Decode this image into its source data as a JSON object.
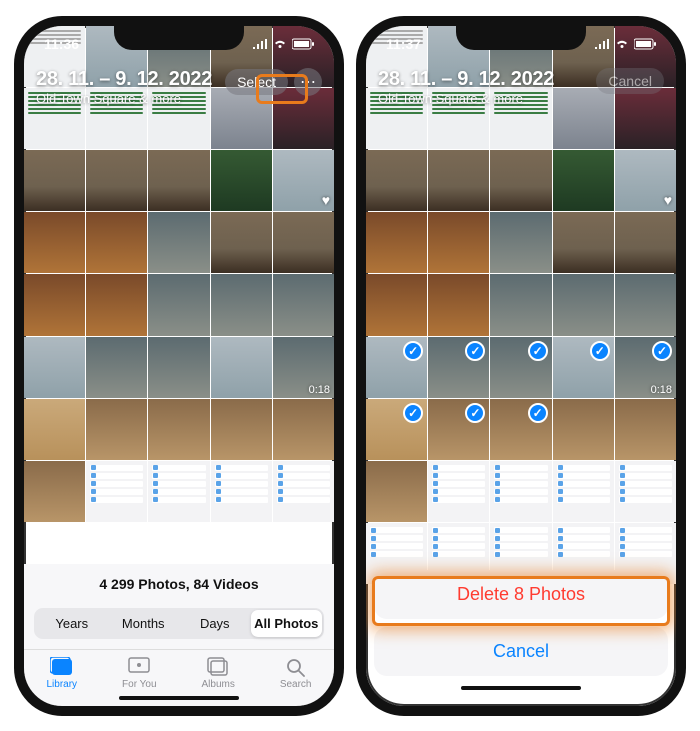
{
  "left": {
    "time": "11:36",
    "date_range": "28. 11. – 9. 12. 2022",
    "subtitle": "Old Town Square & more",
    "select_label": "Select",
    "more_glyph": "⋯",
    "count_text": "4 299 Photos, 84 Videos",
    "segments": {
      "years": "Years",
      "months": "Months",
      "days": "Days",
      "all": "All Photos"
    },
    "tabs": {
      "library": "Library",
      "foryou": "For You",
      "albums": "Albums",
      "search": "Search"
    },
    "video_duration": "0:18",
    "fav_glyph": "♥"
  },
  "right": {
    "time": "11:37",
    "date_range": "28. 11. – 9. 12. 2022",
    "subtitle": "Old Town Square & more",
    "cancel_label": "Cancel",
    "video_duration": "0:18",
    "fav_glyph": "♥",
    "delete_label": "Delete 8 Photos",
    "sheet_cancel": "Cancel",
    "check_glyph": "✓",
    "selected_indices": [
      25,
      26,
      27,
      28,
      29,
      30,
      31,
      32
    ]
  }
}
